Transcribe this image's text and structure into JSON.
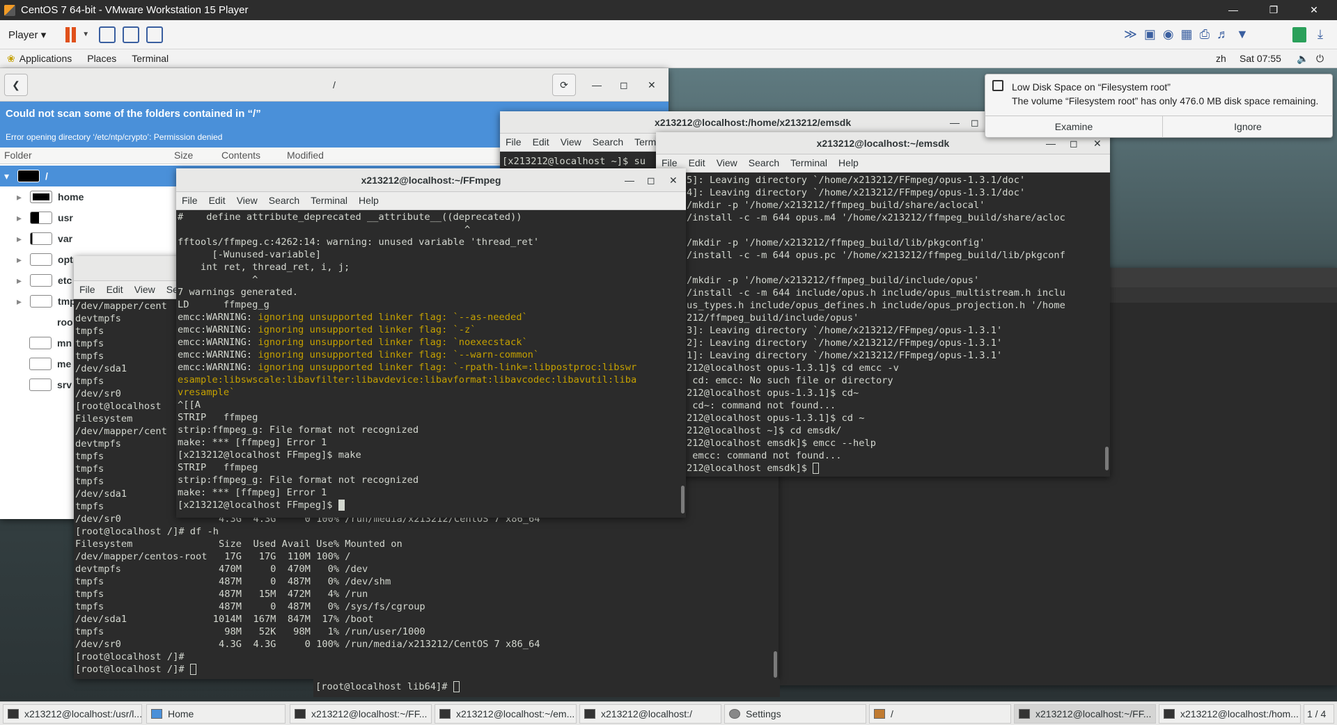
{
  "vmware": {
    "title": "CentOS 7 64-bit - VMware Workstation 15 Player",
    "player_label": "Player",
    "controls": [
      "—",
      "❐",
      "✕"
    ]
  },
  "gnome": {
    "menu": [
      "Applications",
      "Places",
      "Terminal"
    ],
    "lang": "zh",
    "clock": "Sat 07:55"
  },
  "disk_analyzer": {
    "path": "/",
    "banner_title": "Could not scan some of the folders contained in “/”",
    "banner_detail": "Error opening directory ‘/etc/ntp/crypto’: Permission denied",
    "columns": [
      "Folder",
      "Size",
      "Contents",
      "Modified"
    ],
    "rows": [
      "/",
      "home",
      "usr",
      "var",
      "opt",
      "etc",
      "tmp",
      "roo",
      "mn",
      "me",
      "srv"
    ]
  },
  "notification": {
    "title": "Low Disk Space on “Filesystem root”",
    "body": "The volume “Filesystem root” has only 476.0 MB disk space remaining.",
    "examine": "Examine",
    "ignore": "Ignore"
  },
  "term_menu": [
    "File",
    "Edit",
    "View",
    "Search",
    "Terminal",
    "Help"
  ],
  "term_root": {
    "lines": [
      "/dev/mapper/cent",
      "devtmpfs",
      "tmpfs",
      "tmpfs",
      "tmpfs",
      "/dev/sda1",
      "tmpfs",
      "/dev/sr0",
      "[root@localhost",
      "Filesystem",
      "/dev/mapper/cent",
      "devtmpfs",
      "tmpfs",
      "tmpfs",
      "tmpfs",
      "/dev/sda1",
      "tmpfs",
      "/dev/sr0                 4.3G  4.3G     0 100% /run/media/x213212/CentOS 7 x86_64",
      "[root@localhost /]# df -h",
      "Filesystem               Size  Used Avail Use% Mounted on",
      "/dev/mapper/centos-root   17G   17G  110M 100% /",
      "devtmpfs                 470M     0  470M   0% /dev",
      "tmpfs                    487M     0  487M   0% /dev/shm",
      "tmpfs                    487M   15M  472M   4% /run",
      "tmpfs                    487M     0  487M   0% /sys/fs/cgroup",
      "/dev/sda1               1014M  167M  847M  17% /boot",
      "tmpfs                     98M   52K   98M   1% /run/user/1000",
      "/dev/sr0                 4.3G  4.3G     0 100% /run/media/x213212/CentOS 7 x86_64",
      "[root@localhost /]#",
      "[root@localhost /]# "
    ]
  },
  "term_lib64": {
    "prompt": "[root@localhost lib64]# "
  },
  "term_emsdk_back": {
    "title": "x213212@localhost:/home/x213212/emsdk",
    "prompt": "[x213212@localhost ~]$ su"
  },
  "term_emsdk": {
    "title": "x213212@localhost:~/emsdk",
    "lines": [
      "5]: Leaving directory `/home/x213212/FFmpeg/opus-1.3.1/doc'",
      "4]: Leaving directory `/home/x213212/FFmpeg/opus-1.3.1/doc'",
      "/mkdir -p '/home/x213212/ffmpeg_build/share/aclocal'",
      "/install -c -m 644 opus.m4 '/home/x213212/ffmpeg_build/share/acloc",
      "",
      "/mkdir -p '/home/x213212/ffmpeg_build/lib/pkgconfig'",
      "/install -c -m 644 opus.pc '/home/x213212/ffmpeg_build/lib/pkgconf",
      "",
      "/mkdir -p '/home/x213212/ffmpeg_build/include/opus'",
      "/install -c -m 644 include/opus.h include/opus_multistream.h inclu",
      "us_types.h include/opus_defines.h include/opus_projection.h '/home",
      "212/ffmpeg_build/include/opus'",
      "3]: Leaving directory `/home/x213212/FFmpeg/opus-1.3.1'",
      "2]: Leaving directory `/home/x213212/FFmpeg/opus-1.3.1'",
      "1]: Leaving directory `/home/x213212/FFmpeg/opus-1.3.1'",
      "212@localhost opus-1.3.1]$ cd emcc -v",
      " cd: emcc: No such file or directory",
      "212@localhost opus-1.3.1]$ cd~",
      " cd~: command not found...",
      "212@localhost opus-1.3.1]$ cd ~",
      "212@localhost ~]$ cd emsdk/",
      "212@localhost emsdk]$ emcc --help",
      " emcc: command not found...",
      "212@localhost emsdk]$ "
    ]
  },
  "term_ffmpeg": {
    "title": "x213212@localhost:~/FFmpeg",
    "lines": [
      {
        "t": "#    define attribute_deprecated __attribute__((deprecated))",
        "w": false
      },
      {
        "t": "                                                  ^",
        "w": false
      },
      {
        "t": "fftools/ffmpeg.c:4262:14: warning: unused variable 'thread_ret'",
        "w": false
      },
      {
        "t": "      [-Wunused-variable]",
        "w": false
      },
      {
        "t": "    int ret, thread_ret, i, j;",
        "w": false
      },
      {
        "t": "             ^",
        "w": false
      },
      {
        "t": "7 warnings generated.",
        "w": false
      },
      {
        "t": "LD      ffmpeg_g",
        "w": false
      },
      {
        "p": "emcc:WARNING: ",
        "t": "ignoring unsupported linker flag: `--as-needed`",
        "w": true
      },
      {
        "p": "emcc:WARNING: ",
        "t": "ignoring unsupported linker flag: `-z`",
        "w": true
      },
      {
        "p": "emcc:WARNING: ",
        "t": "ignoring unsupported linker flag: `noexecstack`",
        "w": true
      },
      {
        "p": "emcc:WARNING: ",
        "t": "ignoring unsupported linker flag: `--warn-common`",
        "w": true
      },
      {
        "p": "emcc:WARNING: ",
        "t": "ignoring unsupported linker flag: `-rpath-link=:libpostproc:libswr",
        "w": true
      },
      {
        "t": "esample:libswscale:libavfilter:libavdevice:libavformat:libavcodec:libavutil:liba",
        "w": true
      },
      {
        "t": "vresample`",
        "w": true
      },
      {
        "t": "^[[A",
        "w": false
      },
      {
        "t": "STRIP   ffmpeg",
        "w": false
      },
      {
        "t": "strip:ffmpeg_g: File format not recognized",
        "w": false
      },
      {
        "t": "make: *** [ffmpeg] Error 1",
        "w": false
      },
      {
        "t": "[x213212@localhost FFmpeg]$ make",
        "w": false
      },
      {
        "t": "STRIP   ffmpeg",
        "w": false
      },
      {
        "t": "strip:ffmpeg_g: File format not recognized",
        "w": false
      },
      {
        "t": "make: *** [ffmpeg] Error 1",
        "w": false
      },
      {
        "t": "[x213212@localhost FFmpeg]$ ",
        "w": false
      }
    ]
  },
  "taskbar": {
    "tasks": [
      "x213212@localhost:/usr/l...",
      "Home",
      "x213212@localhost:~/FF...",
      "x213212@localhost:~/em...",
      "x213212@localhost:/",
      "Settings",
      "/",
      "x213212@localhost:~/FF...",
      "x213212@localhost:/hom..."
    ],
    "workspace": "1 / 4"
  }
}
